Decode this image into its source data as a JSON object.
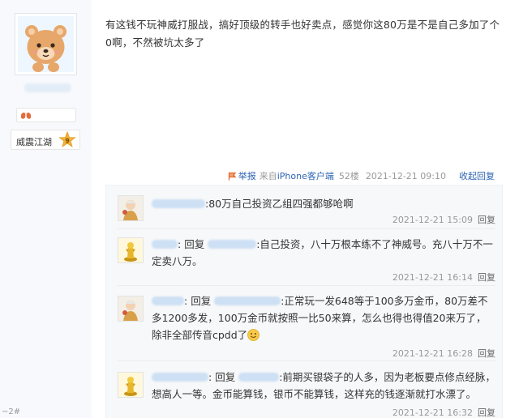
{
  "author": {
    "avatar_icon": "bear-avatar-icon",
    "badge_icon": "lungs-icon",
    "level_name": "威震江湖",
    "level_number": "9"
  },
  "post": {
    "content": "有这钱不玩神威打服战，搞好顶级的转手也好卖点，感觉你这80万是不是自己多加了个0啊，不然被坑太多了",
    "report_label": "举报",
    "client_prefix": "来自",
    "client_name": "iPhone客户端",
    "floor": "52楼",
    "time": "2021-12-21 09:10",
    "collapse_label": "收起回复"
  },
  "replies": [
    {
      "avatar_icon": "figure-avatar-icon",
      "reply_word": "",
      "text": ":80万自己投资乙组四强都够呛啊",
      "emoji": "",
      "time": "2021-12-21 15:09",
      "reply_label": "回复"
    },
    {
      "avatar_icon": "golden-statue-avatar-icon",
      "reply_word": "回复",
      "text": ":自己投资，八十万根本练不了神威号。充八十万不一定卖八万。",
      "emoji": "",
      "time": "2021-12-21 16:14",
      "reply_label": "回复"
    },
    {
      "avatar_icon": "figure-avatar-icon",
      "reply_word": "回复",
      "text": ":正常玩一发648等于100多万金币，80万差不多1200多发，100万金币就按照一比50来算，怎么也得也得值20来万了，除非全部传音cpdd了",
      "emoji": "smile-emoji-icon",
      "time": "2021-12-21 16:28",
      "reply_label": "回复"
    },
    {
      "avatar_icon": "golden-statue-avatar-icon",
      "reply_word": "回复",
      "text": ":前期买银袋子的人多，因为老板要点修点经脉，想高人一等。金币能算钱，银币不能算钱，这样充的钱逐渐就打水漂了。",
      "emoji": "",
      "time": "2021-12-21 16:32",
      "reply_label": "回复"
    }
  ],
  "corner_text": "~2#"
}
